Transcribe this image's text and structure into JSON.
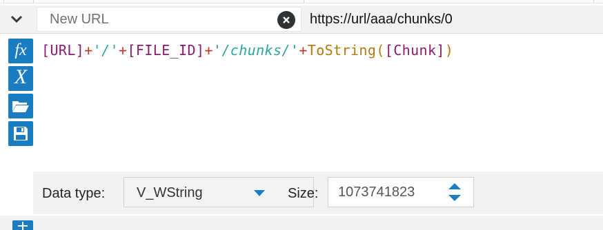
{
  "field_row": {
    "name_placeholder": "New URL",
    "name_value": "",
    "preview_value": "https://url/aaa/chunks/0",
    "icons": {
      "collapse": "chevron-down-icon",
      "clear": "close-circle-icon"
    }
  },
  "toolbar": {
    "buttons": [
      {
        "icon": "function-icon",
        "glyph": "fx"
      },
      {
        "icon": "variable-icon",
        "glyph": "X"
      },
      {
        "icon": "folder-open-icon"
      },
      {
        "icon": "save-icon"
      }
    ]
  },
  "expression": {
    "tokens": [
      {
        "text": "[URL]",
        "kind": "field"
      },
      {
        "text": "+",
        "kind": "op"
      },
      {
        "text": "'/'",
        "kind": "str"
      },
      {
        "text": "+",
        "kind": "op"
      },
      {
        "text": "[FILE_ID]",
        "kind": "field"
      },
      {
        "text": "+",
        "kind": "op"
      },
      {
        "text": "'/chunks/'",
        "kind": "str"
      },
      {
        "text": "+",
        "kind": "op"
      },
      {
        "text": "ToString",
        "kind": "fn"
      },
      {
        "text": "(",
        "kind": "op"
      },
      {
        "text": "[Chunk]",
        "kind": "field"
      },
      {
        "text": ")",
        "kind": "op"
      }
    ]
  },
  "footer": {
    "data_type_label": "Data type:",
    "data_type_value": "V_WString",
    "size_label": "Size:",
    "size_value": "1073741823"
  },
  "colors": {
    "accent": "#1a7dc4",
    "field": "#8a1b70",
    "operator": "#c0392b",
    "string": "#2ea4a0",
    "function": "#b8790c"
  }
}
